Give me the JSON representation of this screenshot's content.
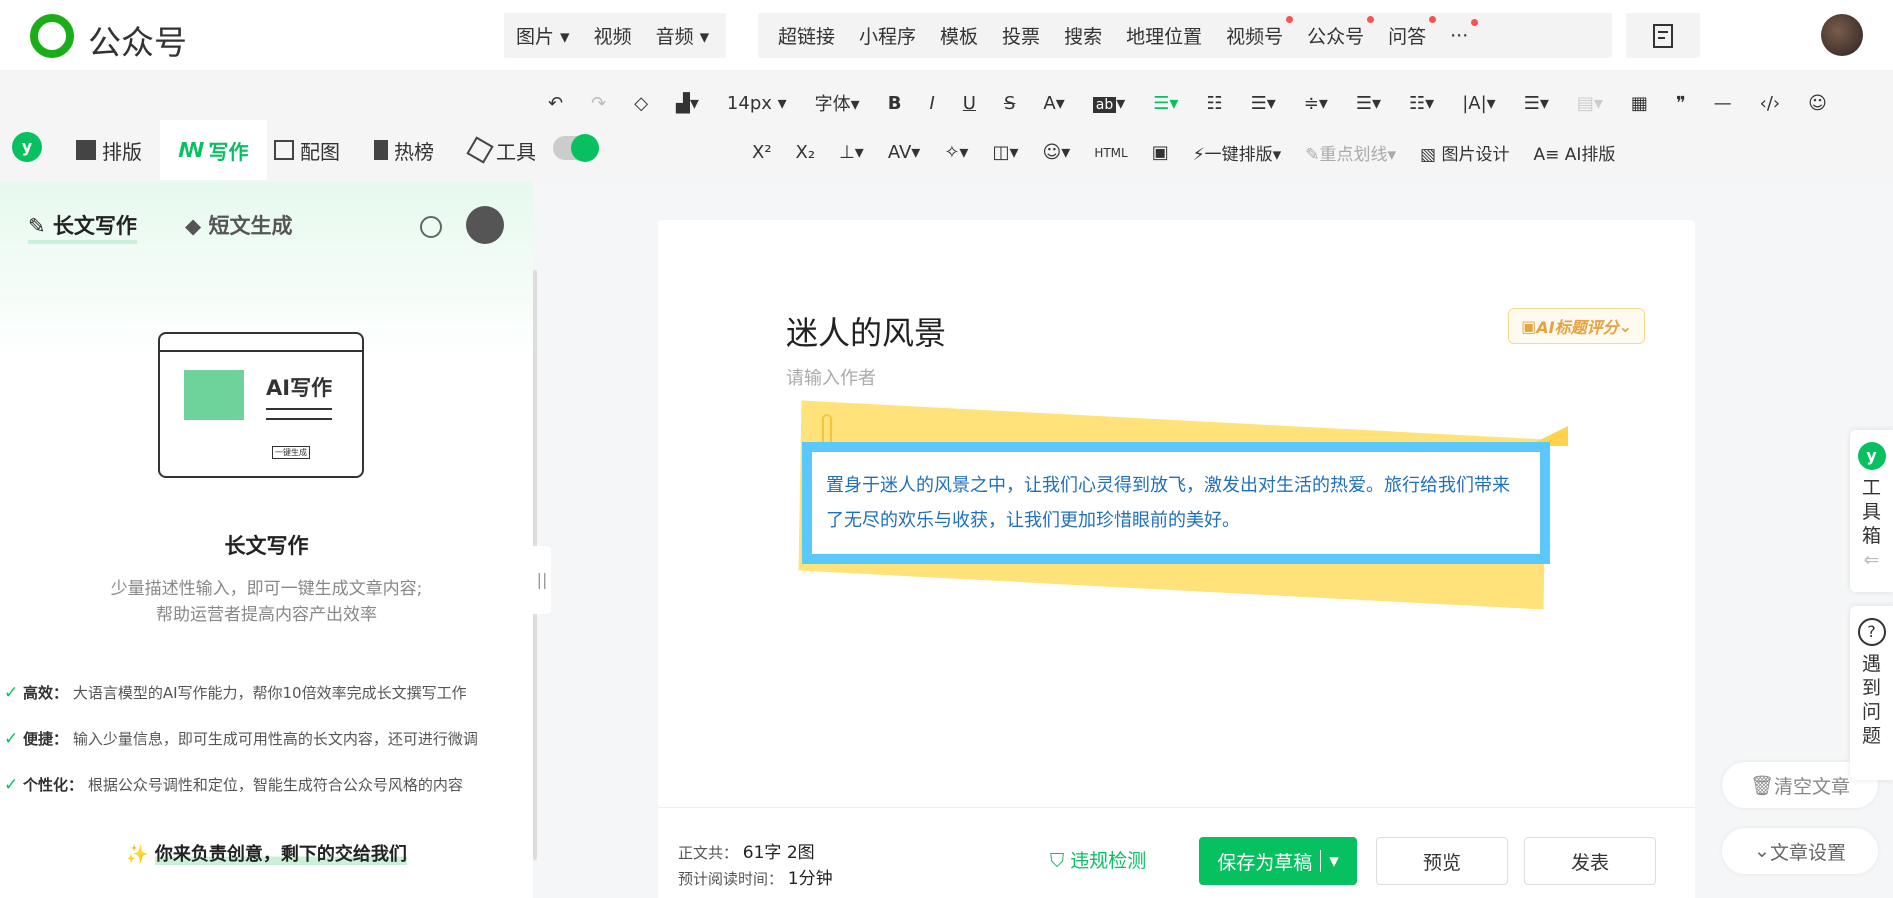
{
  "brand": {
    "title": "公众号"
  },
  "topnav": {
    "media": [
      "图片",
      "视频",
      "音频"
    ],
    "insert": [
      "超链接",
      "小程序",
      "模板",
      "投票",
      "搜索",
      "地理位置",
      "视频号",
      "公众号",
      "问答"
    ],
    "more": "···"
  },
  "toolbar": {
    "font_size": "14px",
    "font_family": "字体",
    "auto_layout": "一键排版",
    "highlight": "重点划线",
    "image_design": "图片设计",
    "ai_layout": "AI排版"
  },
  "tabs": [
    "排版",
    "写作",
    "配图",
    "热榜",
    "工具"
  ],
  "sidebar": {
    "tab_long": "长文写作",
    "tab_short": "短文生成",
    "illustration_title": "AI写作",
    "illustration_btn": "一键生成",
    "heading": "长文写作",
    "desc1": "少量描述性输入，即可一键生成文章内容;",
    "desc2": "帮助运营者提高内容产出效率",
    "features": [
      {
        "label": "高效：",
        "text": "大语言模型的AI写作能力，帮你10倍效率完成长文撰写工作"
      },
      {
        "label": "便捷：",
        "text": "输入少量信息，即可生成可用性高的长文内容，还可进行微调"
      },
      {
        "label": "个性化：",
        "text": "根据公众号调性和定位，智能生成符合公众号风格的内容"
      }
    ],
    "slogan": "你来负责创意，剩下的交给我们"
  },
  "editor": {
    "title": "迷人的风景",
    "author_placeholder": "请输入作者",
    "ai_score": "AI标题评分",
    "content": "置身于迷人的风景之中，让我们心灵得到放飞，激发出对生活的热爱。旅行给我们带来了无尽的欢乐与收获，让我们更加珍惜眼前的美好。"
  },
  "footer": {
    "count_label": "正文共：",
    "count_value": "61字 2图",
    "read_label": "预计阅读时间：",
    "read_value": "1分钟",
    "check": "违规检测",
    "save": "保存为草稿",
    "preview": "预览",
    "publish": "发表",
    "clear": "清空文章",
    "settings": "文章设置"
  },
  "right_panel": {
    "toolbox": [
      "工",
      "具",
      "箱"
    ],
    "help": [
      "遇",
      "到",
      "问",
      "题"
    ]
  },
  "colors": {
    "brand_green": "#07c160",
    "accent_blue": "#5ac8fa",
    "note_yellow": "#ffe27a"
  }
}
